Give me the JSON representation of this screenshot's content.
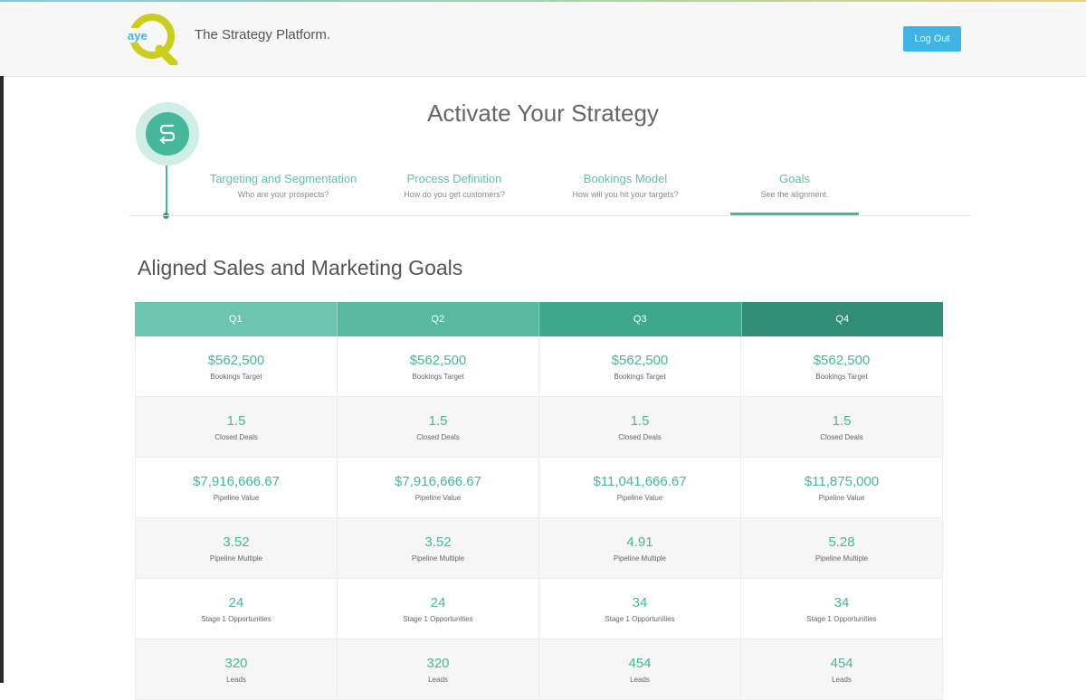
{
  "header": {
    "logo_text": "aye",
    "tagline": "The Strategy Platform.",
    "logout_label": "Log Out"
  },
  "page": {
    "title": "Activate Your Strategy",
    "section_title": "Aligned Sales and Marketing Goals"
  },
  "steps": [
    {
      "title": "Targeting and Segmentation",
      "subtitle": "Who are your prospects?"
    },
    {
      "title": "Process Definition",
      "subtitle": "How do you get customers?"
    },
    {
      "title": "Bookings Model",
      "subtitle": "How will you hit your targets?"
    },
    {
      "title": "Goals",
      "subtitle": "See the alignment."
    }
  ],
  "active_step": "Goals",
  "colors": {
    "accent": "#45b79a",
    "q1": "#6cc5ae",
    "q2": "#59b9a0",
    "q3": "#3fa88c",
    "q4": "#2f8e75",
    "button": "#3fb3e6"
  },
  "table": {
    "quarters": [
      "Q1",
      "Q2",
      "Q3",
      "Q4"
    ],
    "rows": [
      {
        "label": "Bookings Target",
        "values": [
          "$562,500",
          "$562,500",
          "$562,500",
          "$562,500"
        ]
      },
      {
        "label": "Closed Deals",
        "values": [
          "1.5",
          "1.5",
          "1.5",
          "1.5"
        ]
      },
      {
        "label": "Pipeline Value",
        "values": [
          "$7,916,666.67",
          "$7,916,666.67",
          "$11,041,666.67",
          "$11,875,000"
        ]
      },
      {
        "label": "Pipeline Multiple",
        "values": [
          "3.52",
          "3.52",
          "4.91",
          "5.28"
        ]
      },
      {
        "label": "Stage 1 Opportunities",
        "values": [
          "24",
          "24",
          "34",
          "34"
        ]
      },
      {
        "label": "Leads",
        "values": [
          "320",
          "320",
          "454",
          "454"
        ]
      }
    ]
  }
}
